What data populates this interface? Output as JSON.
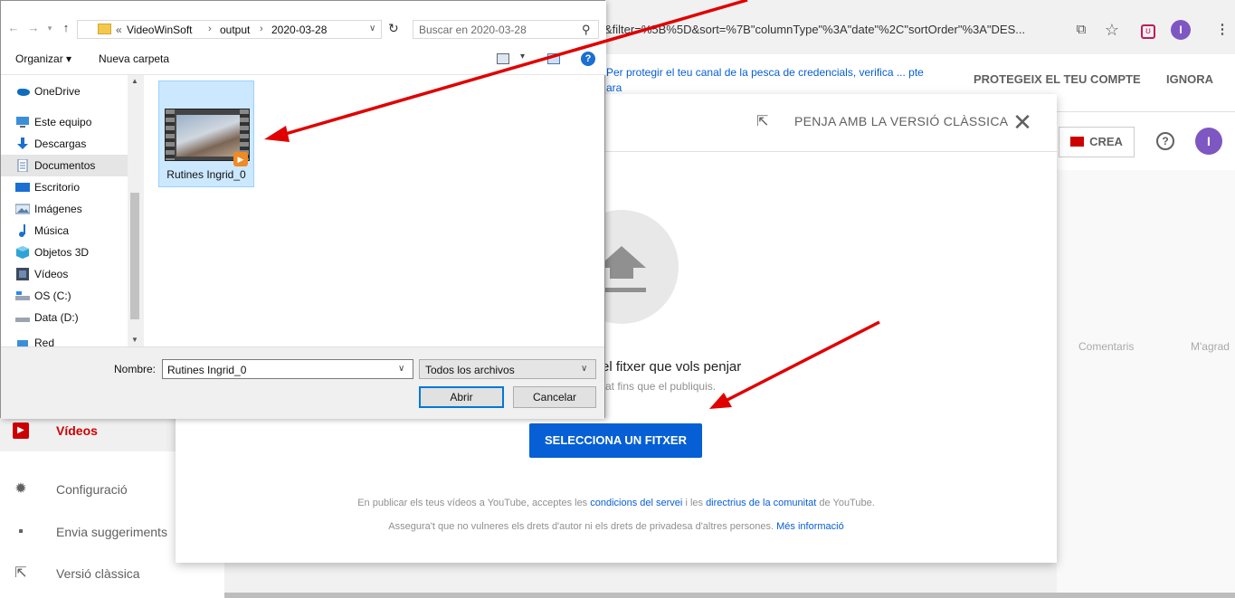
{
  "browser": {
    "url": "&filter=%5B%5D&sort=%7B\"columnType\"%3A\"date\"%2C\"sortOrder\"%3A\"DES...",
    "avatar_letter": "I",
    "menu_glyph": "⋮"
  },
  "youtube": {
    "warning_text": "Per protegir el teu canal de la pesca de credencials, verifica ... pte ara",
    "protect_label": "PROTEGEIX EL TEU COMPTE",
    "ignore_label": "IGNORA",
    "create_label": "CREA",
    "help_glyph": "?",
    "avatar_letter": "I",
    "columns": {
      "comments": "Comentaris",
      "likes": "M'agrad"
    },
    "sidebar": [
      {
        "label": "Vídeos",
        "icon": "videos-icon"
      },
      {
        "label": "Configuració",
        "icon": "settings-icon"
      },
      {
        "label": "Envia suggeriments",
        "icon": "feedback-icon"
      },
      {
        "label": "Versió clàssica",
        "icon": "classic-icon"
      }
    ],
    "accent_color": "#065fd4",
    "brand_red": "#cc0000"
  },
  "upload_dialog": {
    "classic_label": "PENJA AMB LA VERSIÓ CLÀSSICA",
    "close_glyph": "✕",
    "title": "el fitxer que vols penjar",
    "subtitle": "rat fins que el publiquis.",
    "select_button": "SELECCIONA UN FITXER",
    "legal_1_prefix": "En publicar els teus vídeos a YouTube, acceptes les",
    "legal_1_link1": "condicions del servei",
    "legal_1_mid": "i les",
    "legal_1_link2": "directrius de la comunitat",
    "legal_1_suffix": "de YouTube.",
    "legal_2_prefix": "Assegura't que no vulneres els drets d'autor ni els drets de privadesa d'altres persones.",
    "legal_2_link": "Més informació"
  },
  "file_dialog": {
    "breadcrumb_prefix": "«",
    "breadcrumbs": [
      "VideoWinSoft",
      "output",
      "2020-03-28"
    ],
    "search_placeholder": "Buscar en 2020-03-28",
    "organize_label": "Organizar ▾",
    "new_folder_label": "Nueva carpeta",
    "nav_items": [
      {
        "label": "OneDrive",
        "icon": "onedrive-icon"
      },
      {
        "label": "Este equipo",
        "icon": "computer-icon"
      },
      {
        "label": "Descargas",
        "icon": "downloads-icon"
      },
      {
        "label": "Documentos",
        "icon": "documents-icon",
        "selected": true
      },
      {
        "label": "Escritorio",
        "icon": "desktop-icon"
      },
      {
        "label": "Imágenes",
        "icon": "pictures-icon"
      },
      {
        "label": "Música",
        "icon": "music-icon"
      },
      {
        "label": "Objetos 3D",
        "icon": "3d-objects-icon"
      },
      {
        "label": "Vídeos",
        "icon": "videos-folder-icon"
      },
      {
        "label": "OS (C:)",
        "icon": "drive-c-icon"
      },
      {
        "label": "Data (D:)",
        "icon": "drive-d-icon"
      },
      {
        "label": "Red",
        "icon": "network-icon"
      }
    ],
    "file": {
      "name": "Rutines Ingrid_0"
    },
    "filename_label": "Nombre:",
    "filename_value": "Rutines Ingrid_0",
    "filter_value": "Todos los archivos",
    "open_label": "Abrir",
    "cancel_label": "Cancelar"
  }
}
